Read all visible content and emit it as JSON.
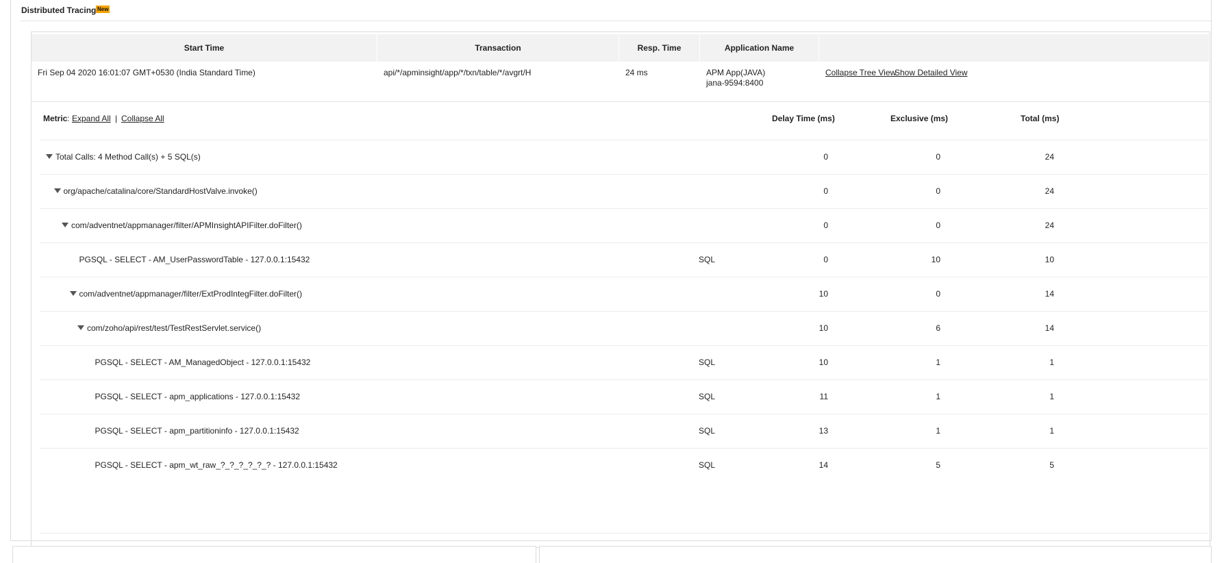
{
  "section": {
    "title": "Distributed Tracing",
    "badge": "New"
  },
  "table": {
    "headers": [
      "Start Time",
      "Transaction",
      "Resp. Time",
      "Application Name",
      ""
    ],
    "row": {
      "start_time": "Fri Sep 04 2020 16:01:07 GMT+0530 (India Standard Time)",
      "transaction": "api/*/apminsight/app/*/txn/table/*/avgrt/H",
      "resp_time": "24 ms",
      "app_name": "APM App(JAVA)",
      "app_host": "jana-9594:8400",
      "collapse_tree": "Collapse Tree View",
      "show_detailed": "Show Detailed View"
    }
  },
  "metric": {
    "label": "Metric",
    "expand_all": "Expand All",
    "sep": "|",
    "collapse_all": "Collapse All",
    "col_delay": "Delay Time (ms)",
    "col_exclusive": "Exclusive (ms)",
    "col_total": "Total (ms)"
  },
  "tree_rows": [
    {
      "label": "Total Calls: 4 Method Call(s) + 5 SQL(s)",
      "level": 0,
      "expandable": true,
      "type": "",
      "delay": "0",
      "exclusive": "0",
      "total": "24"
    },
    {
      "label": "org/apache/catalina/core/StandardHostValve.invoke()",
      "level": 1,
      "expandable": true,
      "type": "",
      "delay": "0",
      "exclusive": "0",
      "total": "24"
    },
    {
      "label": "com/adventnet/appmanager/filter/APMInsightAPIFilter.doFilter()",
      "level": 2,
      "expandable": true,
      "type": "",
      "delay": "0",
      "exclusive": "0",
      "total": "24"
    },
    {
      "label": "PGSQL - SELECT - AM_UserPasswordTable - 127.0.0.1:15432",
      "level": 3,
      "expandable": false,
      "type": "SQL",
      "delay": "0",
      "exclusive": "10",
      "total": "10"
    },
    {
      "label": "com/adventnet/appmanager/filter/ExtProdIntegFilter.doFilter()",
      "level": 3,
      "expandable": true,
      "type": "",
      "delay": "10",
      "exclusive": "0",
      "total": "14"
    },
    {
      "label": "com/zoho/api/rest/test/TestRestServlet.service()",
      "level": 4,
      "expandable": true,
      "type": "",
      "delay": "10",
      "exclusive": "6",
      "total": "14"
    },
    {
      "label": "PGSQL - SELECT - AM_ManagedObject - 127.0.0.1:15432",
      "level": 5,
      "expandable": false,
      "type": "SQL",
      "delay": "10",
      "exclusive": "1",
      "total": "1"
    },
    {
      "label": "PGSQL - SELECT - apm_applications - 127.0.0.1:15432",
      "level": 5,
      "expandable": false,
      "type": "SQL",
      "delay": "11",
      "exclusive": "1",
      "total": "1"
    },
    {
      "label": "PGSQL - SELECT - apm_partitioninfo - 127.0.0.1:15432",
      "level": 5,
      "expandable": false,
      "type": "SQL",
      "delay": "13",
      "exclusive": "1",
      "total": "1"
    },
    {
      "label": "PGSQL - SELECT - apm_wt_raw_?_?_?_?_?_? - 127.0.0.1:15432",
      "level": 5,
      "expandable": false,
      "type": "SQL",
      "delay": "14",
      "exclusive": "5",
      "total": "5"
    }
  ],
  "colors": {
    "badge": "#f5a400",
    "header_bg": "#f2f2f2",
    "border": "#dcdcdc"
  }
}
